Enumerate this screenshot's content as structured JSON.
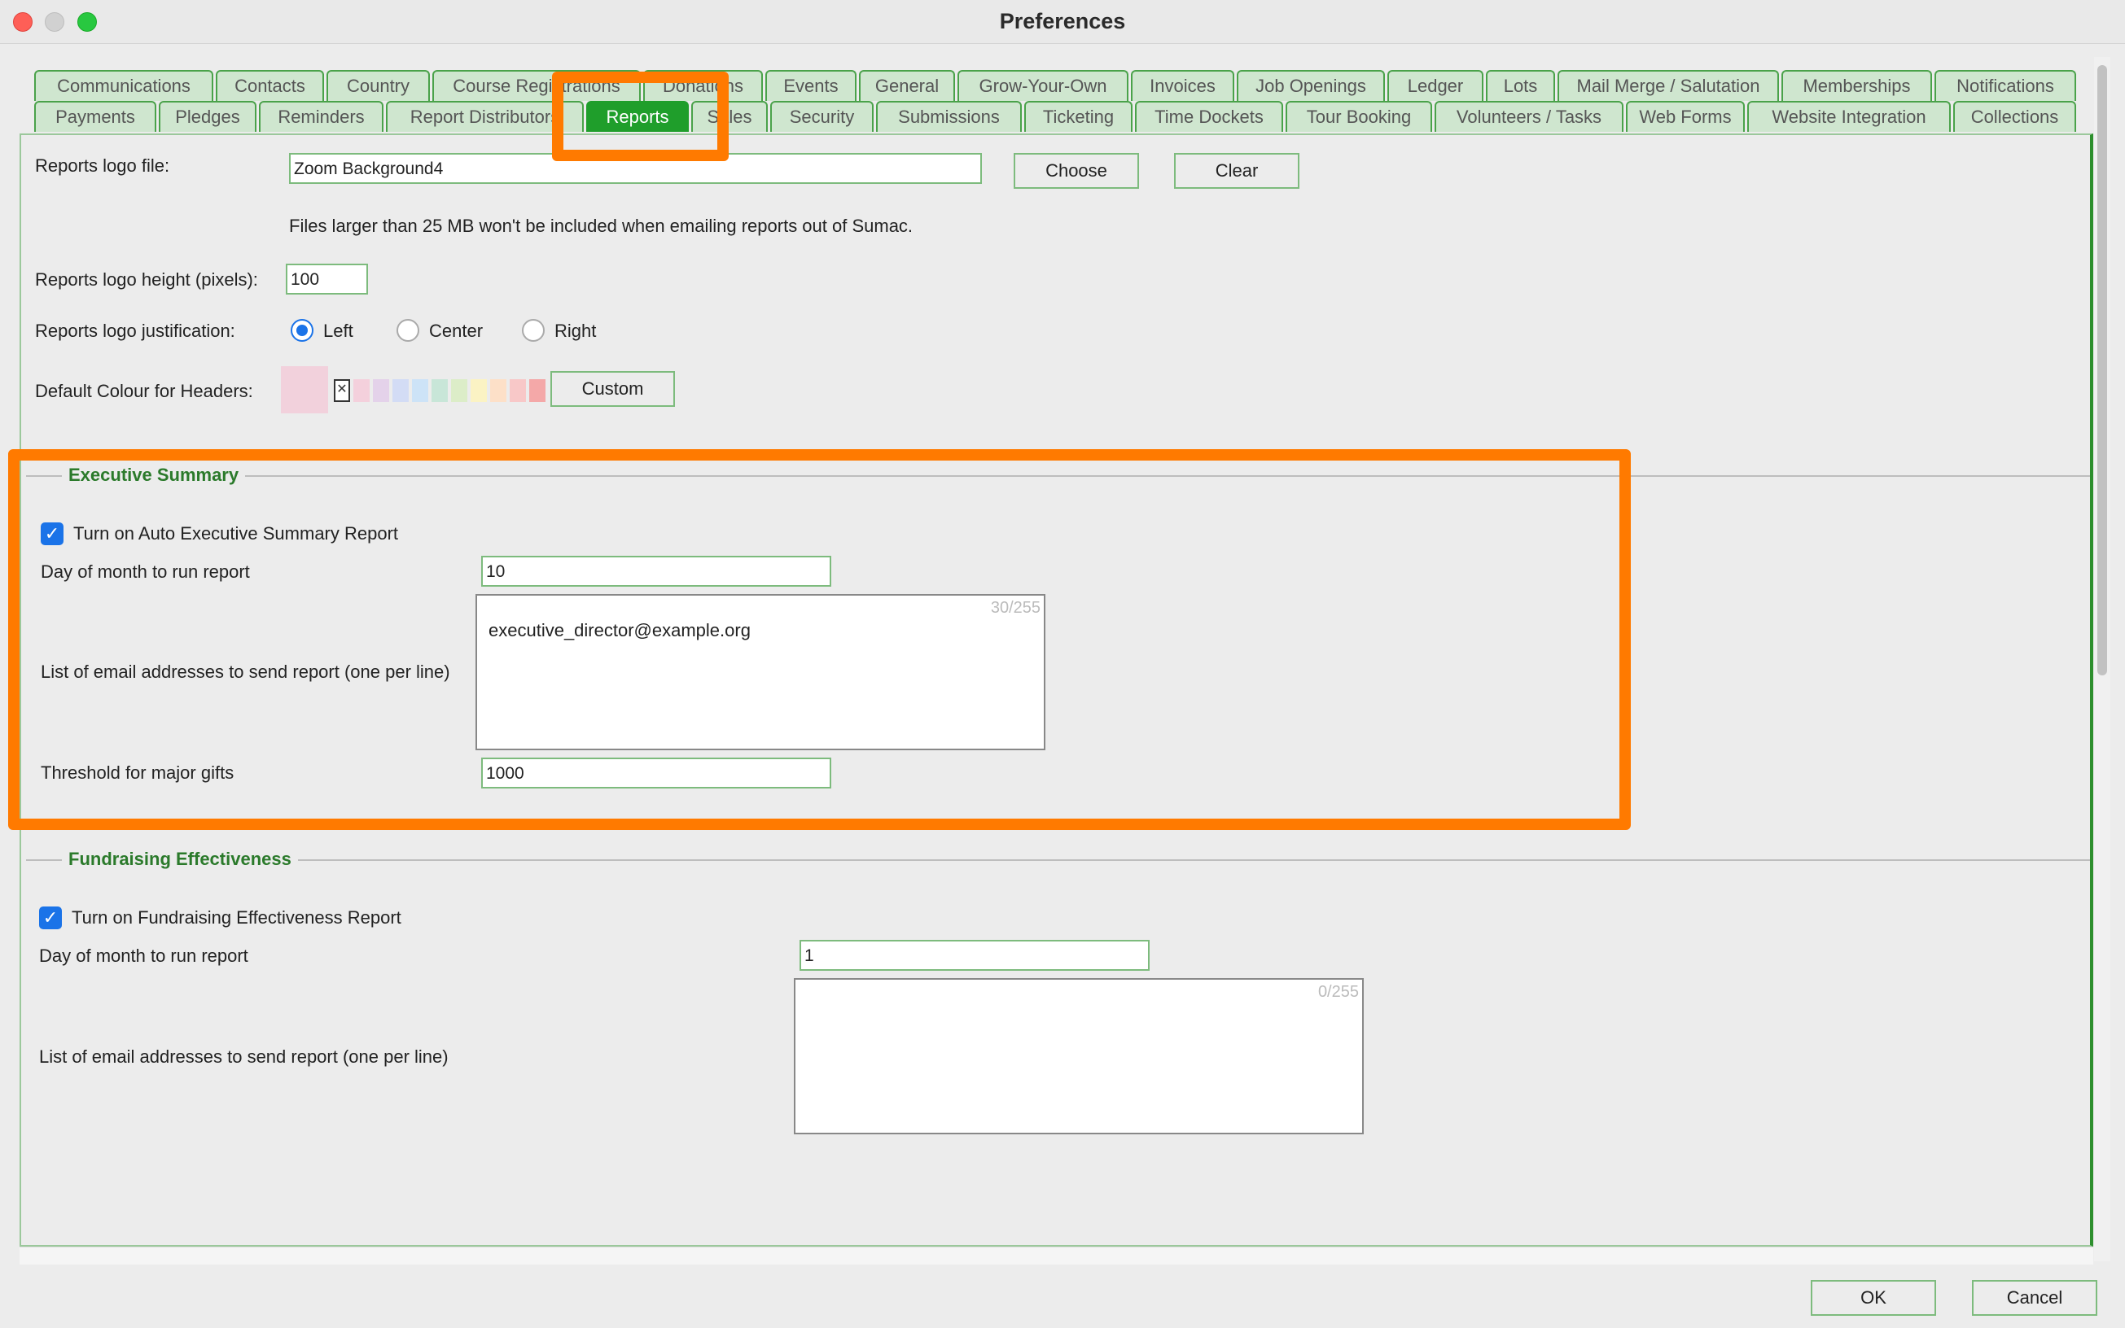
{
  "window": {
    "title": "Preferences"
  },
  "tabs_row1": [
    "Communications",
    "Contacts",
    "Country",
    "Course Registrations",
    "Donations",
    "Events",
    "General",
    "Grow-Your-Own",
    "Invoices",
    "Job Openings",
    "Ledger",
    "Lots",
    "Mail Merge / Salutation",
    "Memberships",
    "Notifications"
  ],
  "tabs_row2": [
    "Payments",
    "Pledges",
    "Reminders",
    "Report Distributors",
    "Reports",
    "Sales",
    "Security",
    "Submissions",
    "Ticketing",
    "Time Dockets",
    "Tour Booking",
    "Volunteers / Tasks",
    "Web Forms",
    "Website Integration",
    "Collections"
  ],
  "active_tab": "Reports",
  "reports": {
    "logo_file_label": "Reports logo file:",
    "logo_file_value": "Zoom Background4",
    "choose_label": "Choose",
    "clear_label": "Clear",
    "size_note": "Files larger than 25 MB won't be included when emailing reports out of Sumac.",
    "logo_height_label": "Reports logo height (pixels):",
    "logo_height_value": "100",
    "justification_label": "Reports logo justification:",
    "justification_options": [
      "Left",
      "Center",
      "Right"
    ],
    "justification_selected": "Left",
    "header_colour_label": "Default Colour for Headers:",
    "custom_label": "Custom",
    "header_colour_selected": "#f2d1dc",
    "swatch_colors": [
      "#f4d0dc",
      "#e4d2ea",
      "#d3dcf5",
      "#cde3f7",
      "#c8e6d8",
      "#dcedc8",
      "#fbf3c4",
      "#fde0c8",
      "#f8c8c8",
      "#f4a8a8"
    ]
  },
  "executive_summary": {
    "title": "Executive Summary",
    "enable_label": "Turn on Auto Executive Summary Report",
    "enabled": true,
    "day_label": "Day of month to run report",
    "day_value": "10",
    "emails_label": "List of email addresses to send report (one per line)",
    "emails_value": "executive_director@example.org",
    "emails_counter": "30/255",
    "threshold_label": "Threshold for major gifts",
    "threshold_value": "1000"
  },
  "fundraising": {
    "title": "Fundraising Effectiveness",
    "enable_label": "Turn on Fundraising Effectiveness Report",
    "enabled": true,
    "day_label": "Day of month to run report",
    "day_value": "1",
    "emails_label": "List of email addresses to send report (one per line)",
    "emails_value": "",
    "emails_counter": "0/255"
  },
  "footer": {
    "ok_label": "OK",
    "cancel_label": "Cancel"
  },
  "colors": {
    "accent_green": "#1f9e2b",
    "highlight": "#ff7a00",
    "checkbox_blue": "#1a73e8"
  }
}
